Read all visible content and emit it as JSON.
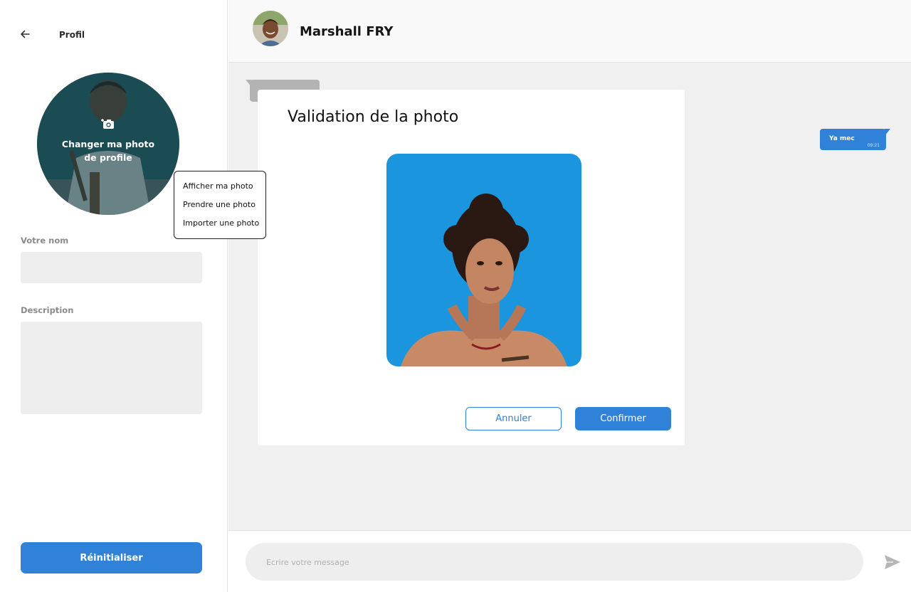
{
  "sidebar": {
    "title": "Profil",
    "back_icon": "arrow-left-icon",
    "avatar": {
      "change_label": "Changer ma photo de profile",
      "camera_icon": "camera-add-icon"
    },
    "photo_menu": [
      {
        "label": "Afficher ma photo"
      },
      {
        "label": "Prendre une photo"
      },
      {
        "label": "Importer une photo"
      }
    ],
    "name_field": {
      "label": "Votre nom",
      "value": ""
    },
    "description_field": {
      "label": "Description",
      "value": ""
    },
    "reset_button": "Réinitialiser"
  },
  "chat": {
    "contact_name": "Marshall FRY",
    "messages": [
      {
        "side": "left",
        "text": ""
      },
      {
        "side": "right",
        "text": "Ya mec",
        "time": "09:21"
      }
    ],
    "composer": {
      "placeholder": "Ecrire votre message",
      "send_icon": "send-icon"
    }
  },
  "modal": {
    "title": "Validation de la photo",
    "cancel_button": "Annuler",
    "confirm_button": "Confirmer"
  },
  "colors": {
    "accent": "#2f82d8",
    "chat_background": "#f0f0f0",
    "input_background": "#eeeeee",
    "received_bubble": "#b3b3b3"
  }
}
